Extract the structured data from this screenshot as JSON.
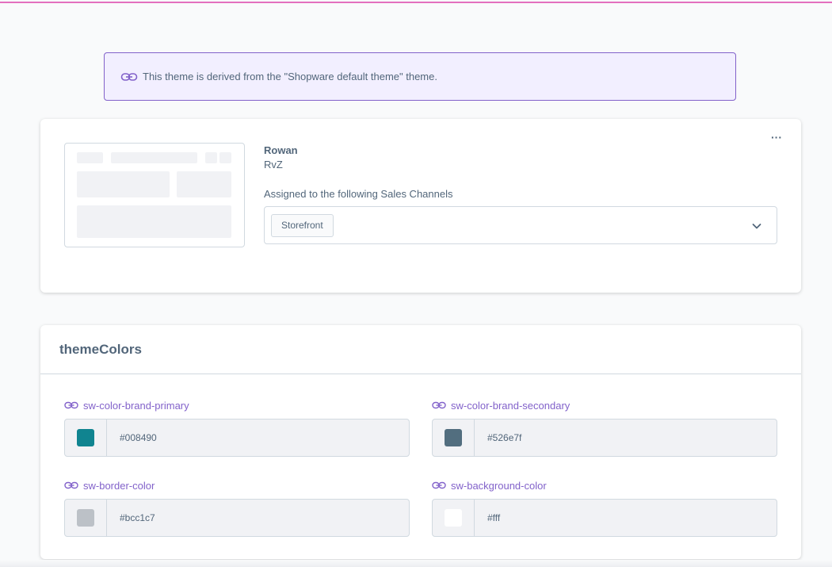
{
  "notice": {
    "text": "This theme is derived from the \"Shopware default theme\" theme.",
    "icon": "link-icon"
  },
  "theme": {
    "name": "Rowan",
    "author": "RvZ",
    "assigned_label": "Assigned to the following Sales Channels",
    "sales_channels": [
      "Storefront"
    ],
    "menu_icon": "more-dots-icon",
    "more_label": "···"
  },
  "theme_colors": {
    "title": "themeColors",
    "fields": [
      {
        "label": "sw-color-brand-primary",
        "value": "#008490",
        "swatch": "#108490"
      },
      {
        "label": "sw-color-brand-secondary",
        "value": "#526e7f",
        "swatch": "#526e7f"
      },
      {
        "label": "sw-border-color",
        "value": "#bcc1c7",
        "swatch": "#bcc1c7"
      },
      {
        "label": "sw-background-color",
        "value": "#fff",
        "swatch": "#ffffff"
      }
    ]
  },
  "colors": {
    "accent": "#8262ca",
    "text": "#52667a",
    "border": "#d1d9e0",
    "top_line": "#e36fbe"
  }
}
